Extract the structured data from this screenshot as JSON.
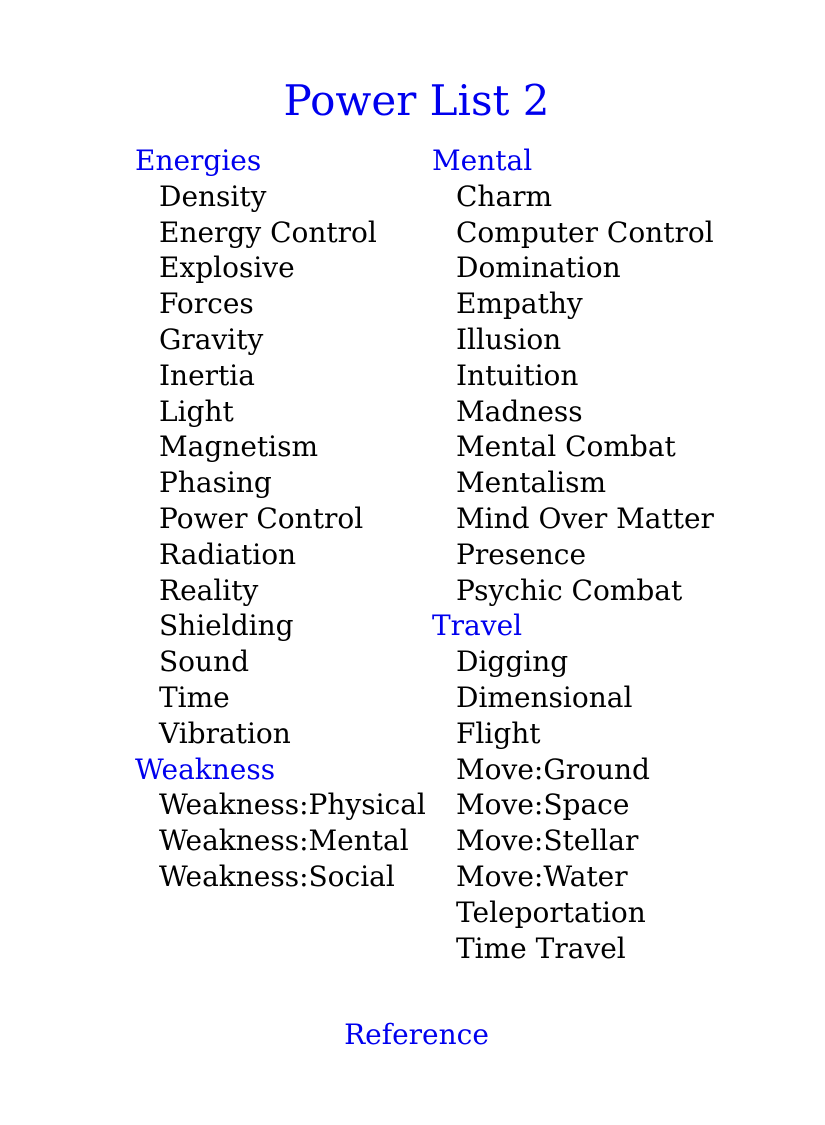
{
  "title": "Power List 2",
  "colors": {
    "heading": "#0000ee",
    "text": "#000000",
    "background": "#ffffff"
  },
  "left_column": [
    {
      "heading": "Energies",
      "items": [
        "Density",
        "Energy Control",
        "Explosive",
        "Forces",
        "Gravity",
        "Inertia",
        "Light",
        "Magnetism",
        "Phasing",
        "Power Control",
        "Radiation",
        "Reality",
        "Shielding",
        "Sound",
        "Time",
        "Vibration"
      ]
    },
    {
      "heading": "Weakness",
      "items": [
        "Weakness:Physical",
        "Weakness:Mental",
        "Weakness:Social"
      ]
    }
  ],
  "right_column": [
    {
      "heading": "Mental",
      "items": [
        "Charm",
        "Computer Control",
        "Domination",
        "Empathy",
        "Illusion",
        "Intuition",
        "Madness",
        "Mental Combat",
        "Mentalism",
        "Mind Over Matter",
        "Presence",
        "Psychic Combat"
      ]
    },
    {
      "heading": "Travel",
      "items": [
        "Digging",
        "Dimensional",
        "Flight",
        "Move:Ground",
        "Move:Space",
        "Move:Stellar",
        "Move:Water",
        "Teleportation",
        "Time Travel"
      ]
    }
  ],
  "footer": {
    "link_label": "Reference"
  }
}
